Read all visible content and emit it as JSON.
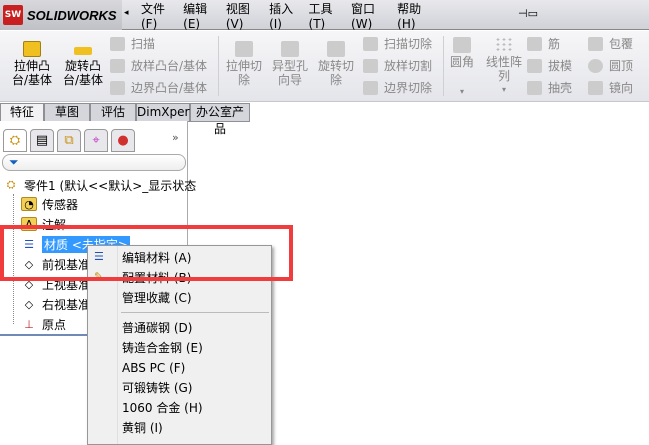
{
  "app": {
    "logo_text": "SOLIDWORKS",
    "logo_badge": "SW"
  },
  "menu": [
    "文件(F)",
    "编辑(E)",
    "视图(V)",
    "插入(I)",
    "工具(T)",
    "窗口(W)",
    "帮助(H)"
  ],
  "toolbar": {
    "extrude_boss": [
      "拉伸凸",
      "台/基体"
    ],
    "revolve_boss": [
      "旋转凸",
      "台/基体"
    ],
    "sweep": "扫描",
    "loft": "放样凸台/基体",
    "boundary": "边界凸台/基体",
    "extrude_cut": [
      "拉伸切",
      "除"
    ],
    "hole_wizard": [
      "异型孔",
      "向导"
    ],
    "revolve_cut": [
      "旋转切",
      "除"
    ],
    "swept_cut": "扫描切除",
    "lofted_cut": "放样切割",
    "boundary_cut": "边界切除",
    "fillet": "圆角",
    "linear_pattern": [
      "线性阵",
      "列"
    ],
    "rib": "筋",
    "draft": "拔模",
    "shell": "抽壳",
    "wrap": "包覆",
    "dome": "圆顶",
    "mirror": "镜向"
  },
  "tabs": [
    "特征",
    "草图",
    "评估",
    "DimXpert",
    "办公室产品"
  ],
  "tree": {
    "root": "零件1  (默认<<默认>_显示状态",
    "items": [
      "传感器",
      "注解",
      "材质 <未指定>",
      "前视基准面",
      "上视基准面",
      "右视基准面",
      "原点"
    ]
  },
  "context_menu": {
    "items": [
      "编辑材料 (A)",
      "配置材料 (B)",
      "管理收藏 (C)",
      "普通碳钢 (D)",
      "铸造合金钢 (E)",
      "ABS PC (F)",
      "可锻铸铁 (G)",
      "1060 合金 (H)",
      "黄铜 (I)"
    ]
  },
  "colors": {
    "highlight": "#3399ff",
    "annotation": "#f03c3c"
  }
}
